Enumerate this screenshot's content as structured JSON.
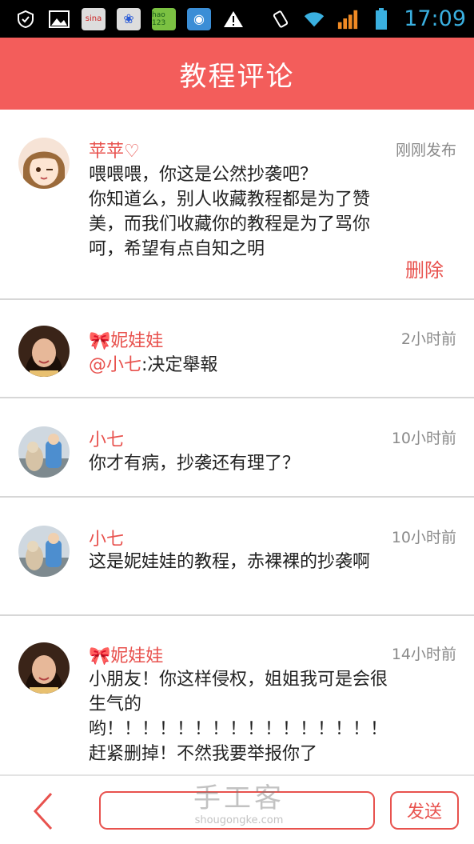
{
  "status_bar": {
    "time": "17:09",
    "icons": [
      "shield-icon",
      "image-icon",
      "sina-icon",
      "baidu-paw-icon",
      "hao123-icon",
      "globe-icon",
      "warning-icon",
      "vibrate-icon",
      "wifi-icon",
      "signal-icon",
      "battery-icon"
    ],
    "sina_label": "sina",
    "hao_label": "hao 123"
  },
  "header": {
    "title": "教程评论"
  },
  "comments": [
    {
      "author": "苹苹♡",
      "time": "刚刚发布",
      "text": "喂喂喂，你这是公然抄袭吧？\n你知道么，别人收藏教程都是为了赞美，而我们收藏你的教程是为了骂你\n呵，希望有点自知之明",
      "delete_label": "删除"
    },
    {
      "author": "🎀妮娃娃",
      "time": "2小时前",
      "mention": "@小七",
      "text": ":决定舉報"
    },
    {
      "author": "小七",
      "time": "10小时前",
      "text": "你才有病，抄袭还有理了？"
    },
    {
      "author": "小七",
      "time": "10小时前",
      "text": "这是妮娃娃的教程，赤裸裸的抄袭啊"
    },
    {
      "author": "🎀妮娃娃",
      "time": "14小时前",
      "text": "小朋友！你这样侵权，姐姐我可是会很生气的\n哟！！！！！！！！！！！！！！！！\n赶紧删掉！不然我要举报你了"
    }
  ],
  "bottom_bar": {
    "input_value": "",
    "input_placeholder": "",
    "send_label": "发送"
  },
  "watermark": {
    "main": "手工客",
    "sub": "shougongke.com"
  },
  "colors": {
    "accent": "#f35d5b",
    "name": "#e8524e"
  }
}
